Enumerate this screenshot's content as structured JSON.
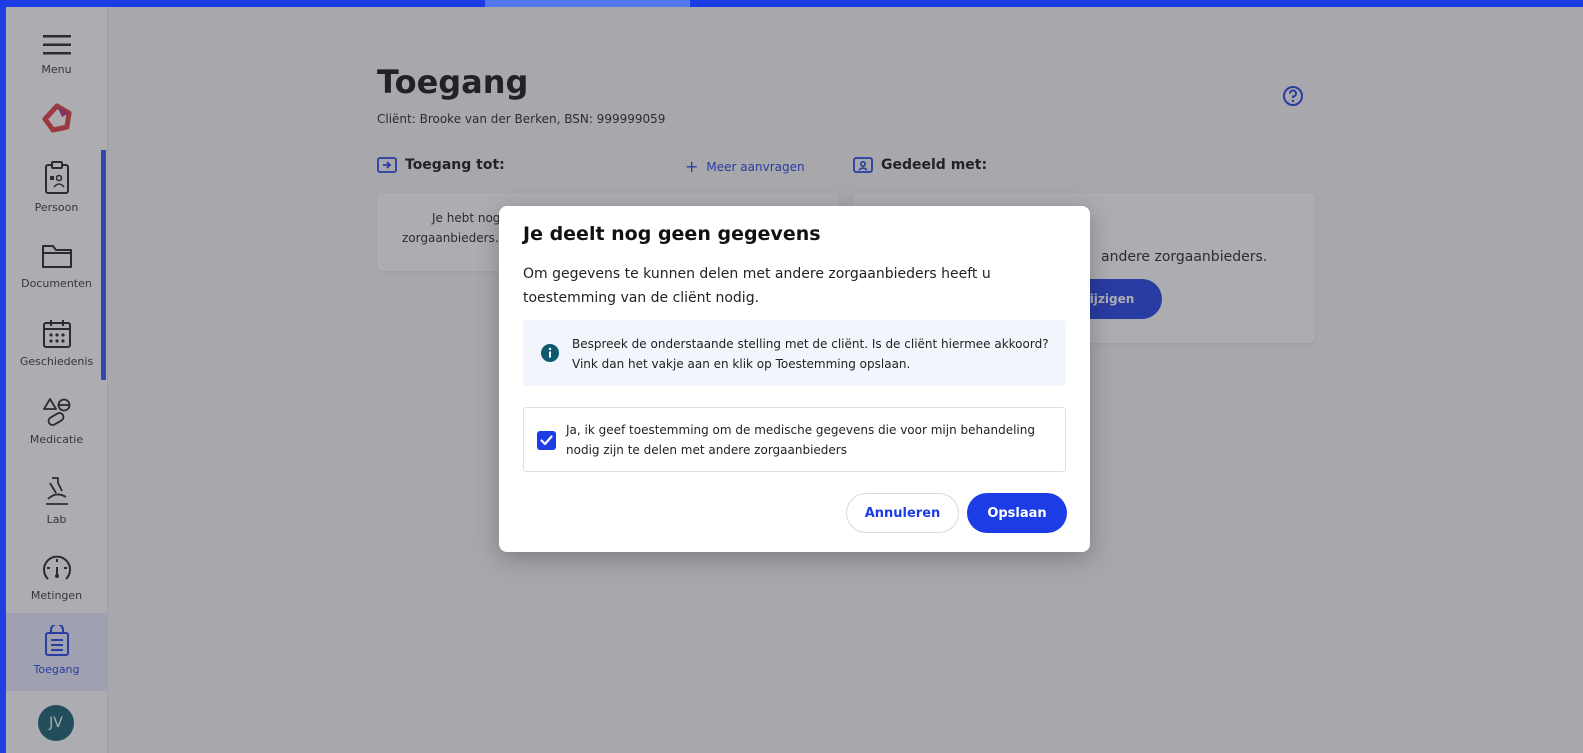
{
  "sidebar": {
    "menu_label": "Menu",
    "items": [
      {
        "label": "Persoon",
        "icon": "clipboard-person-icon"
      },
      {
        "label": "Documenten",
        "icon": "folder-icon"
      },
      {
        "label": "Geschiedenis",
        "icon": "calendar-icon"
      },
      {
        "label": "Medicatie",
        "icon": "medication-icon"
      },
      {
        "label": "Lab",
        "icon": "microscope-icon"
      },
      {
        "label": "Metingen",
        "icon": "gauge-icon"
      },
      {
        "label": "Toegang",
        "icon": "lock-clipboard-icon"
      }
    ],
    "active": "Toegang",
    "avatar_initials": "JV"
  },
  "page": {
    "title": "Toegang",
    "client_info": "Cliënt: Brooke van der Berken, BSN: 999999059",
    "toegang_tot_label": "Toegang tot:",
    "meer_aanvragen_label": "Meer aanvragen",
    "gedeeld_met_label": "Gedeeld met:",
    "left_card_text_1": "Je hebt nog",
    "left_card_text_2": "zorgaanbieders.",
    "right_card_text": "andere zorgaanbieders.",
    "right_card_button": "ijzigen"
  },
  "modal": {
    "title": "Je deelt nog geen gegevens",
    "description": "Om gegevens te kunnen delen met andere zorgaanbieders heeft u toestemming van de cliënt nodig.",
    "info_text": "Bespreek de onderstaande stelling met de cliënt. Is de cliënt hiermee akkoord? Vink dan het vakje aan en klik op Toestemming opslaan.",
    "consent_text": "Ja, ik geef toestemming om de medische gegevens die voor mijn behandeling nodig zijn te delen met andere zorgaanbieders",
    "consent_checked": true,
    "cancel_label": "Annuleren",
    "save_label": "Opslaan"
  },
  "colors": {
    "brand": "#1c3de6",
    "logo": "#e0373f"
  }
}
